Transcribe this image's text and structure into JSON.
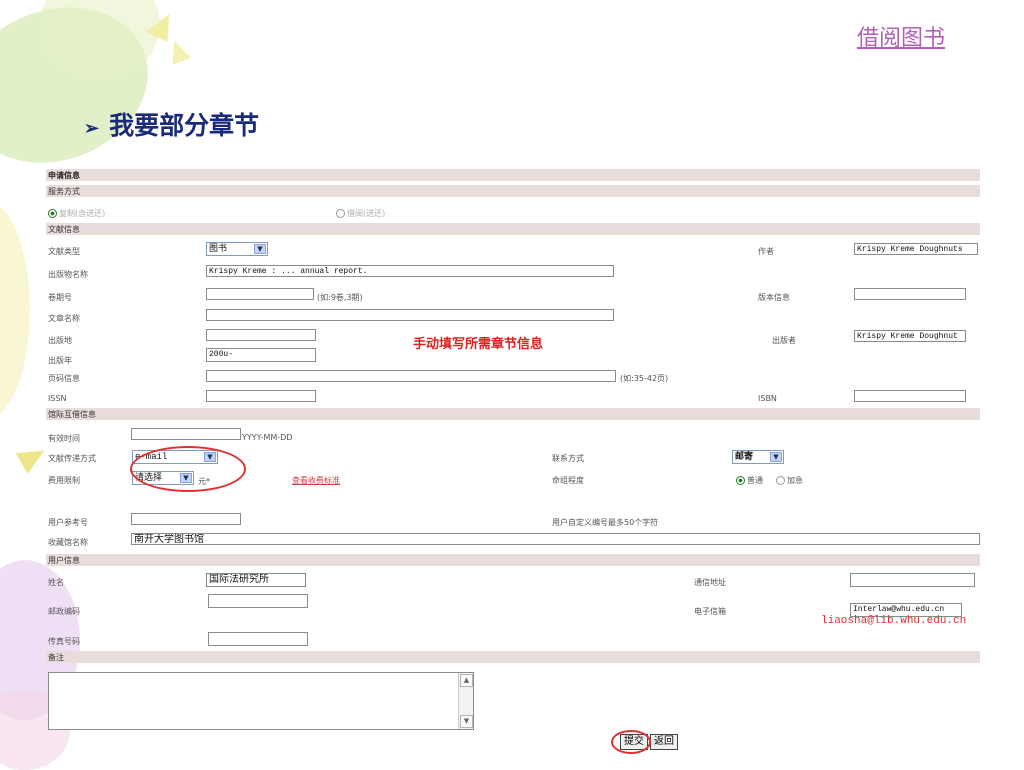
{
  "top_link": "借阅图书",
  "heading": "我要部分章节",
  "form": {
    "sections": {
      "application_info": "申请信息",
      "service_mode": "服务方式",
      "doc_info": "文献信息",
      "interlibrary_info": "馆际互借信息",
      "user_info": "用户信息",
      "remarks": "备注"
    },
    "service": {
      "copy": "复制(含送还)",
      "loan": "借阅(送还)"
    },
    "doc": {
      "type_label": "文献类型",
      "type_value": "图书",
      "author_label": "作者",
      "author_value": "Krispy Kreme Doughnuts",
      "pub_name_label": "出版物名称",
      "pub_name_value": "Krispy Kreme : ... annual report.",
      "volume_label": "卷期号",
      "volume_hint": "(如:9卷,3期)",
      "edition_label": "版本信息",
      "article_label": "文章名称",
      "place_label": "出版地",
      "publisher_label": "出版者",
      "publisher_value": "Krispy Kreme Doughnut",
      "year_label": "出版年",
      "year_value": "200u-",
      "pages_label": "页码信息",
      "pages_hint": "(如:35-42页)",
      "issn_label": "ISSN",
      "isbn_label": "ISBN"
    },
    "red_note": "手动填写所需章节信息",
    "ill": {
      "valid_label": "有效时间",
      "date_hint": "YYYY-MM-DD",
      "delivery_label": "文献传递方式",
      "delivery_value": "e-mail",
      "contact_label": "联系方式",
      "contact_value": "邮寄",
      "fee_label": "费用限制",
      "fee_value": "请选择",
      "fee_unit": "元*",
      "fee_link": "查看收费标准",
      "urgency_label": "命组程度",
      "urgency_normal": "普通",
      "urgency_urgent": "加急",
      "ref_label": "用户参考号",
      "ref_hint": "用户自定义编号最多50个字符",
      "library_label": "收藏馆名称",
      "library_value": "南开大学图书馆"
    },
    "user": {
      "name_label": "姓名",
      "name_value": "国际法研究所",
      "address_label": "通信地址",
      "zip_label": "邮政编码",
      "email_label": "电子信箱",
      "email_value": "Interlaw@whu.edu.cn",
      "fax_label": "传真号码"
    },
    "email_note": "liaosha@lib.whu.edu.cn",
    "buttons": {
      "submit": "提交",
      "back": "返回"
    }
  }
}
